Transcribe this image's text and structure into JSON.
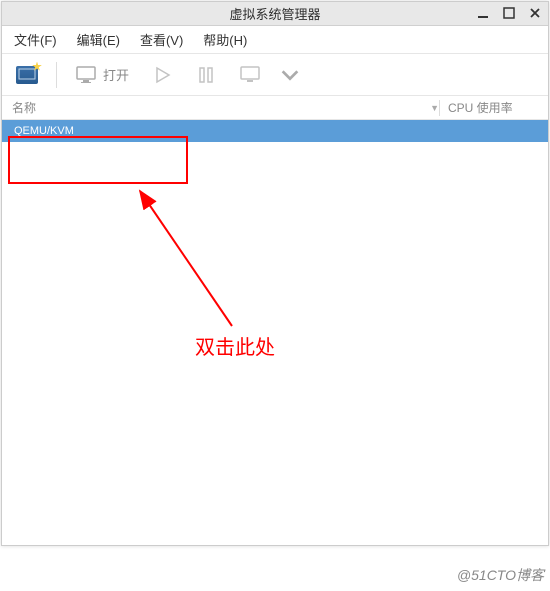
{
  "titlebar": {
    "title": "虚拟系统管理器"
  },
  "menubar": {
    "file": "文件(F)",
    "edit": "编辑(E)",
    "view": "查看(V)",
    "help": "帮助(H)"
  },
  "toolbar": {
    "new_vm": "新建虚拟机",
    "open_label": "打开",
    "play": "运行",
    "pause": "暂停",
    "shutdown": "关机"
  },
  "columns": {
    "name": "名称",
    "cpu": "CPU 使用率"
  },
  "list": {
    "connection_label": "QEMU/KVM"
  },
  "annotation": {
    "text": "双击此处"
  },
  "watermark": "@51CTO博客",
  "icons": {
    "minimize": "minimize-icon",
    "maximize": "maximize-icon",
    "close": "close-icon",
    "new_vm": "new-vm-icon",
    "monitor": "monitor-icon",
    "play": "play-icon",
    "pause": "pause-icon",
    "shutdown": "shutdown-icon",
    "dropdown": "chevron-down-icon",
    "sort": "caret-down-icon"
  }
}
